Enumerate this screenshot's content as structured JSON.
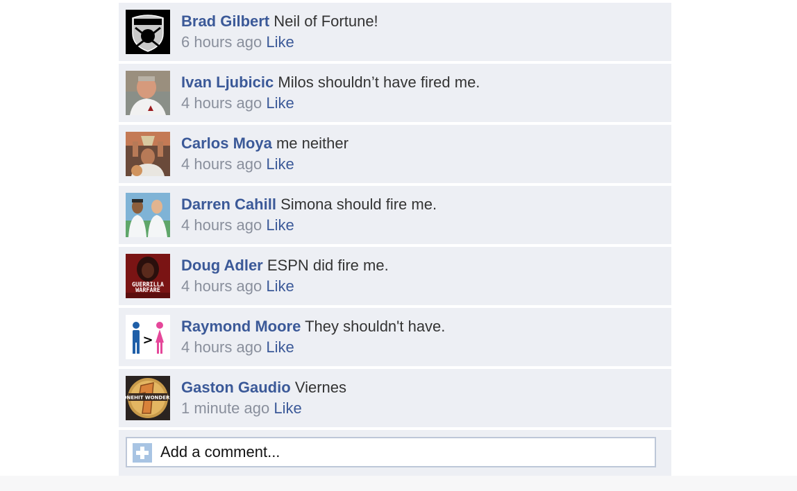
{
  "comments": [
    {
      "author": "Brad Gilbert",
      "message": "Neil of Fortune!",
      "time": "6 hours ago",
      "like_label": "Like",
      "avatar_icon": "raiders-shield-icon"
    },
    {
      "author": "Ivan Ljubicic",
      "message": "Milos shouldn’t have fired me.",
      "time": "4 hours ago",
      "like_label": "Like",
      "avatar_icon": "coach-photo-icon"
    },
    {
      "author": "Carlos Moya",
      "message": "me neither",
      "time": "4 hours ago",
      "like_label": "Like",
      "avatar_icon": "trophy-photo-icon"
    },
    {
      "author": "Darren Cahill",
      "message": "Simona should fire me.",
      "time": "4 hours ago",
      "like_label": "Like",
      "avatar_icon": "players-photo-icon"
    },
    {
      "author": "Doug Adler",
      "message": "ESPN did fire me.",
      "time": "4 hours ago",
      "like_label": "Like",
      "avatar_icon": "guerrilla-warfare-icon",
      "avatar_text": [
        "GUERRILLA",
        "WARFARE"
      ]
    },
    {
      "author": "Raymond Moore",
      "message": "They shouldn't have.",
      "time": "4 hours ago",
      "like_label": "Like",
      "avatar_icon": "man-greater-than-woman-icon",
      "avatar_text": [
        ">"
      ]
    },
    {
      "author": "Gaston Gaudio",
      "message": "Viernes",
      "time": "1 minute ago",
      "like_label": "Like",
      "avatar_icon": "one-hit-wonders-icon",
      "avatar_text": [
        "ONEHIT WONDERS"
      ]
    }
  ],
  "add_comment": {
    "placeholder": "Add a comment...",
    "icon": "plus-icon"
  },
  "colors": {
    "author_link": "#3b5998",
    "row_background": "#edeff4",
    "timestamp": "#898f9c"
  }
}
